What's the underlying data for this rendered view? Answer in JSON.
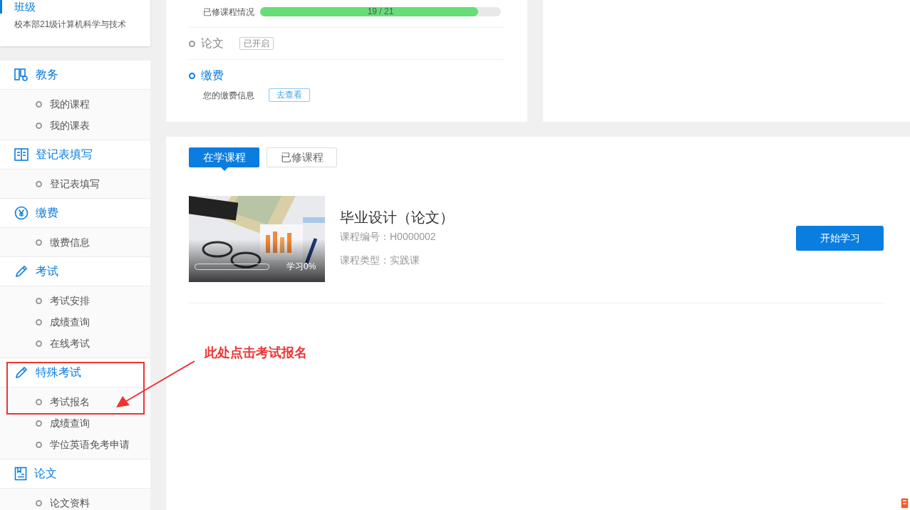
{
  "class_card": {
    "title": "班级",
    "subtitle": "校本部21级计算机科学与技术"
  },
  "sidebar": {
    "groups": [
      {
        "label": "教务",
        "boxed": false,
        "items": [
          "我的课程",
          "我的课表"
        ]
      },
      {
        "label": "登记表填写",
        "boxed": false,
        "items": [
          "登记表填写"
        ]
      },
      {
        "label": "缴费",
        "boxed": false,
        "items": [
          "缴费信息"
        ]
      },
      {
        "label": "考试",
        "boxed": false,
        "items": [
          "考试安排",
          "成绩查询",
          "在线考试"
        ]
      },
      {
        "label": "特殊考试",
        "boxed": true,
        "items": [
          "考试报名",
          "成绩查询",
          "学位英语免考申请"
        ]
      },
      {
        "label": "论文",
        "boxed": false,
        "items": [
          "论文资料"
        ]
      }
    ]
  },
  "status_card": {
    "progress": {
      "label": "已修课程情况",
      "reading": "19 / 21",
      "level": 0.905
    },
    "steps": [
      {
        "label": "论文",
        "active": false,
        "tag": "已开启"
      },
      {
        "label": "缴费",
        "active": true,
        "note": "您的缴费信息",
        "link": "去查看"
      }
    ]
  },
  "tabs": [
    {
      "label": "在学课程",
      "selected": true
    },
    {
      "label": "已修课程",
      "selected": false
    }
  ],
  "course": {
    "title": "毕业设计（论文）",
    "code": "课程编号：H0000002",
    "type": "课程类型：实践课",
    "progress": {
      "level": 0,
      "reading": "学习0%"
    },
    "button": "开始学习"
  },
  "annotation": {
    "text": "此处点击考试报名"
  }
}
